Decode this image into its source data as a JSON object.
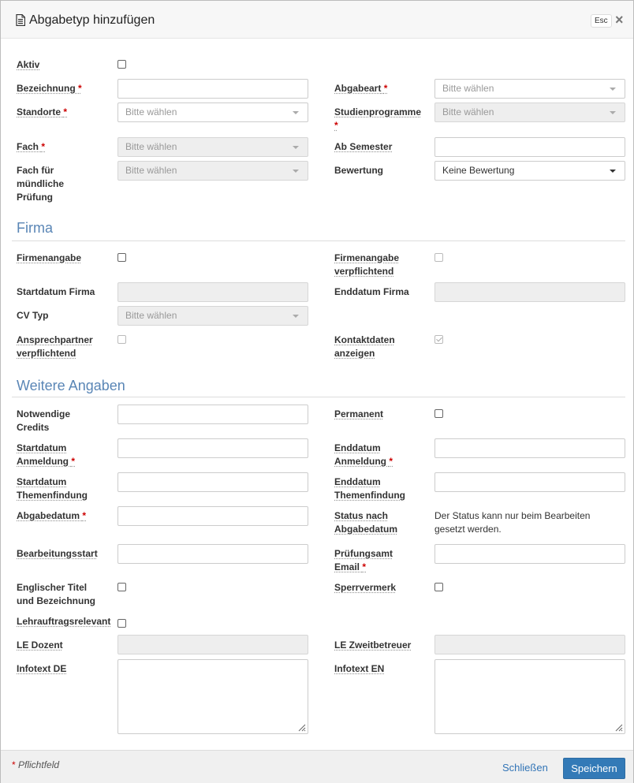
{
  "modal": {
    "title": "Abgabetyp hinzufügen",
    "esc_label": "Esc",
    "close_label": "×"
  },
  "labels": {
    "aktiv": "Aktiv",
    "bezeichnung": "Bezeichnung",
    "abgabeart": "Abgabeart",
    "standorte": "Standorte",
    "studienprogramme": "Studienprogramme",
    "fach": "Fach",
    "ab_semester": "Ab Semester",
    "fach_muendlich_1": "Fach für",
    "fach_muendlich_2": "mündliche",
    "fach_muendlich_3": "Prüfung",
    "bewertung": "Bewertung",
    "firmenangabe": "Firmenangabe",
    "firmenangabe_pflicht_1": "Firmenangabe",
    "firmenangabe_pflicht_2": "verpflichtend",
    "startdatum_firma": "Startdatum Firma",
    "enddatum_firma": "Enddatum Firma",
    "cv_typ": "CV Typ",
    "ansprech_1": "Ansprechpartner",
    "ansprech_2": "verpflichtend",
    "kontakt_1": "Kontaktdaten",
    "kontakt_2": "anzeigen",
    "credits_1": "Notwendige",
    "credits_2": "Credits",
    "permanent": "Permanent",
    "start_anm_1": "Startdatum",
    "start_anm_2": "Anmeldung",
    "end_anm_1": "Enddatum",
    "end_anm_2": "Anmeldung",
    "start_thema_1": "Startdatum",
    "start_thema_2": "Themenfindung",
    "end_thema_1": "Enddatum",
    "end_thema_2": "Themenfindung",
    "abgabedatum": "Abgabedatum",
    "status_1": "Status nach",
    "status_2": "Abgabedatum",
    "bearbeitungsstart": "Bearbeitungsstart",
    "pruefungsamt_1": "Prüfungsamt",
    "pruefungsamt_2": "Email",
    "englisch_1": "Englischer Titel",
    "englisch_2": "und Bezeichnung",
    "sperrvermerk": "Sperrvermerk",
    "lehrauftrag": "Lehrauftragsrelevant",
    "le_dozent": "LE Dozent",
    "le_zweit": "LE Zweitbetreuer",
    "infotext_de": "Infotext DE",
    "infotext_en": "Infotext EN",
    "required_mark": "*"
  },
  "placeholders": {
    "select": "Bitte wählen"
  },
  "values": {
    "bewertung": "Keine Bewertung"
  },
  "info": {
    "status_line_1": "Der Status kann nur beim Bearbeiten",
    "status_line_2": "gesetzt werden."
  },
  "sections": {
    "firma": "Firma",
    "weitere": "Weitere Angaben"
  },
  "footer": {
    "required_note": "Pflichtfeld",
    "required_star": "*",
    "close_label": "Schließen",
    "save_label": "Speichern"
  },
  "checkboxes": {
    "aktiv": false,
    "firmenangabe": false,
    "firmenangabe_pflicht": false,
    "ansprech": false,
    "kontakt": true,
    "permanent": false,
    "englisch": false,
    "sperrvermerk": false,
    "lehrauftrag": false
  },
  "colors": {
    "accent": "#337ab7",
    "section": "#5a86b6",
    "required": "#cc0000"
  },
  "icons": {
    "header": "document-icon",
    "close": "close-icon",
    "dropdown": "caret-down-icon"
  }
}
